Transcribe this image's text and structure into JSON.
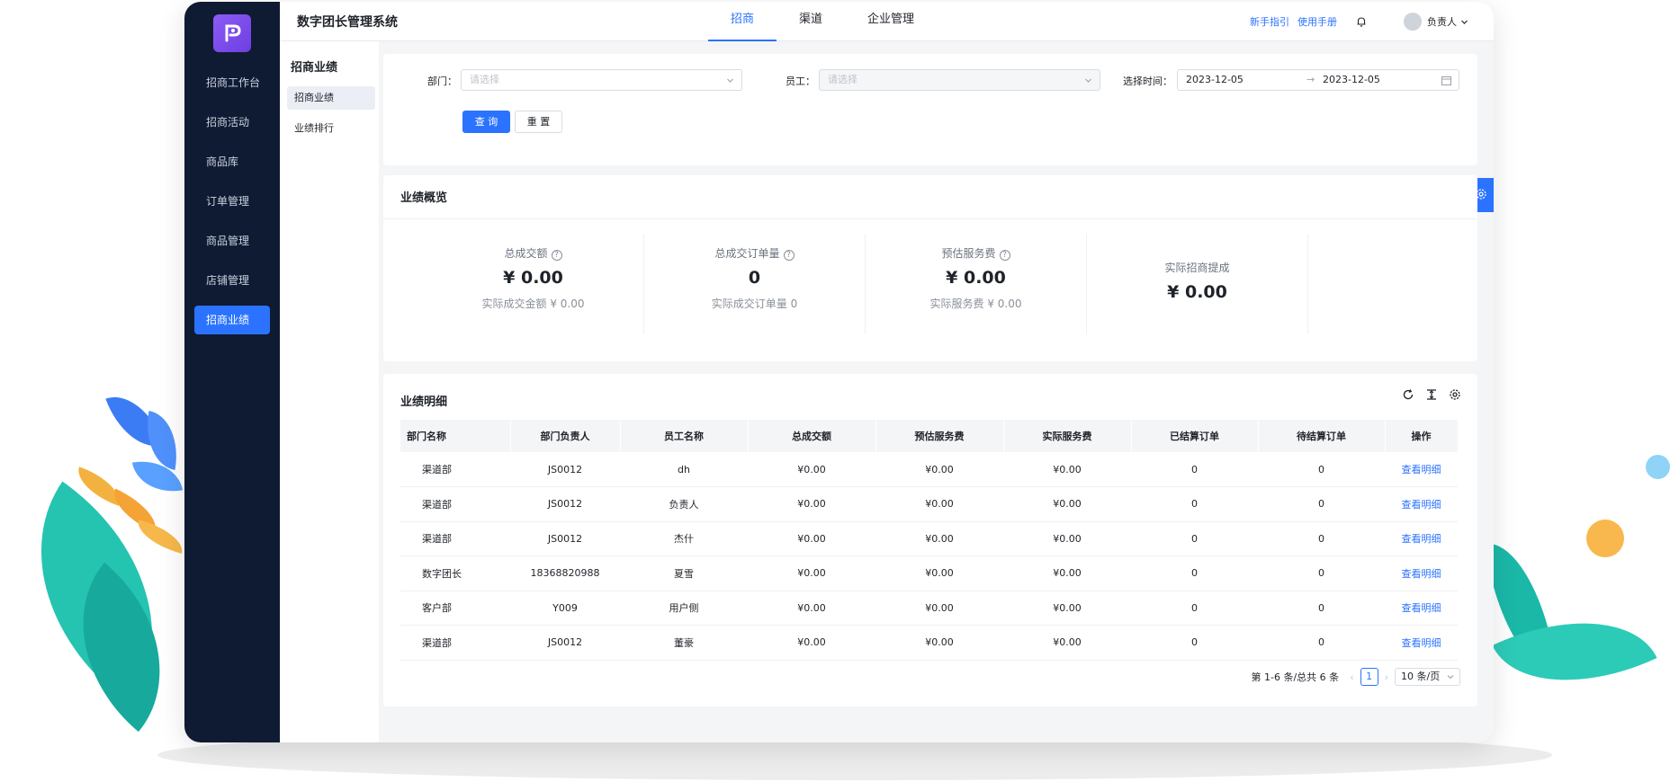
{
  "app": {
    "title": "数字团长管理系统",
    "accent_color": "#2b73ff",
    "sidebar_color": "#0f1b33"
  },
  "sidebar": {
    "logo_icon": "logo-icon",
    "items": [
      {
        "label": "招商工作台",
        "active": false
      },
      {
        "label": "招商活动",
        "active": false
      },
      {
        "label": "商品库",
        "active": false
      },
      {
        "label": "订单管理",
        "active": false
      },
      {
        "label": "商品管理",
        "active": false
      },
      {
        "label": "店铺管理",
        "active": false
      },
      {
        "label": "招商业绩",
        "active": true
      }
    ]
  },
  "header": {
    "tabs": [
      {
        "label": "招商",
        "active": true
      },
      {
        "label": "渠道",
        "active": false
      },
      {
        "label": "企业管理",
        "active": false
      }
    ],
    "links": {
      "guide": "新手指引",
      "manual": "使用手册"
    },
    "notification_icon": "bell-icon",
    "user": {
      "name": "负责人"
    }
  },
  "subnav": {
    "title": "招商业绩",
    "items": [
      {
        "label": "招商业绩",
        "active": true
      },
      {
        "label": "业绩排行",
        "active": false
      }
    ]
  },
  "filters": {
    "department": {
      "label": "部门：",
      "placeholder": "请选择"
    },
    "employee": {
      "label": "员工：",
      "placeholder": "请选择"
    },
    "date": {
      "label": "选择时间：",
      "start": "2023-12-05",
      "end": "2023-12-05",
      "separator": "→"
    },
    "query_button": "查 询",
    "reset_button": "重 置"
  },
  "overview": {
    "title": "业绩概览",
    "stats": [
      {
        "label": "总成交额",
        "value": "¥ 0.00",
        "sub": "实际成交金额 ¥ 0.00",
        "help": true
      },
      {
        "label": "总成交订单量",
        "value": "0",
        "sub": "实际成交订单量 0",
        "help": true
      },
      {
        "label": "预估服务费",
        "value": "¥ 0.00",
        "sub": "实际服务费 ¥ 0.00",
        "help": true
      },
      {
        "label": "实际招商提成",
        "value": "¥ 0.00",
        "sub": "",
        "help": false
      }
    ]
  },
  "details": {
    "title": "业绩明细",
    "toolbar_icons": [
      "refresh-icon",
      "column-height-icon",
      "settings-icon"
    ],
    "columns": [
      "部门名称",
      "部门负责人",
      "员工名称",
      "总成交额",
      "预估服务费",
      "实际服务费",
      "已结算订单",
      "待结算订单",
      "操作"
    ],
    "rows": [
      [
        "渠道部",
        "JS0012",
        "dh",
        "¥0.00",
        "¥0.00",
        "¥0.00",
        "0",
        "0",
        "查看明细"
      ],
      [
        "渠道部",
        "JS0012",
        "负责人",
        "¥0.00",
        "¥0.00",
        "¥0.00",
        "0",
        "0",
        "查看明细"
      ],
      [
        "渠道部",
        "JS0012",
        "杰什",
        "¥0.00",
        "¥0.00",
        "¥0.00",
        "0",
        "0",
        "查看明细"
      ],
      [
        "数字团长",
        "18368820988",
        "夏雪",
        "¥0.00",
        "¥0.00",
        "¥0.00",
        "0",
        "0",
        "查看明细"
      ],
      [
        "客户部",
        "Y009",
        "用户侧",
        "¥0.00",
        "¥0.00",
        "¥0.00",
        "0",
        "0",
        "查看明细"
      ],
      [
        "渠道部",
        "JS0012",
        "董豪",
        "¥0.00",
        "¥0.00",
        "¥0.00",
        "0",
        "0",
        "查看明细"
      ]
    ],
    "pagination": {
      "summary": "第 1-6 条/总共 6 条",
      "prev": "‹",
      "current_page": "1",
      "next": "›",
      "page_size": "10 条/页"
    }
  }
}
